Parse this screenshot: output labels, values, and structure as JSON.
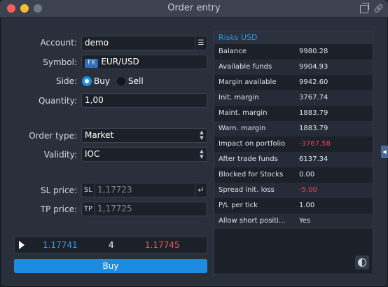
{
  "window": {
    "title": "Order entry"
  },
  "form": {
    "account": {
      "label": "Account:",
      "value": "demo"
    },
    "symbol": {
      "label": "Symbol:",
      "badge": "FX",
      "value": "EUR/USD"
    },
    "side": {
      "label": "Side:",
      "buy": "Buy",
      "sell": "Sell",
      "selected": "Buy"
    },
    "quantity": {
      "label": "Quantity:",
      "value": "1,00"
    },
    "order_type": {
      "label": "Order type:",
      "value": "Market"
    },
    "validity": {
      "label": "Validity:",
      "value": "IOC"
    },
    "sl_price": {
      "label": "SL price:",
      "prefix": "SL",
      "placeholder": "1,17723"
    },
    "tp_price": {
      "label": "TP price:",
      "prefix": "TP",
      "placeholder": "1,17725"
    }
  },
  "quote": {
    "bid": "1.17741",
    "quantity": "4",
    "ask": "1.17745"
  },
  "buy_button": {
    "label": "Buy"
  },
  "risks": {
    "title": "Risks USD",
    "rows": [
      {
        "name": "Balance",
        "value": "9980.28"
      },
      {
        "name": "Available funds",
        "value": "9904.93"
      },
      {
        "name": "Margin available",
        "value": "9942.60"
      },
      {
        "name": "Init. margin",
        "value": "3767.74"
      },
      {
        "name": "Maint. margin",
        "value": "1883.79"
      },
      {
        "name": "Warn. margin",
        "value": "1883.79"
      },
      {
        "name": "Impact on portfolio",
        "value": "-3767.58"
      },
      {
        "name": "After trade funds",
        "value": "6137.34"
      },
      {
        "name": "Blocked for Stocks",
        "value": "0.00"
      },
      {
        "name": "Spread init. loss",
        "value": "-5.00"
      },
      {
        "name": "P/L per tick",
        "value": "1.00"
      },
      {
        "name": "Allow short positi...",
        "value": "Yes"
      }
    ]
  },
  "colors": {
    "accent": "#1d8ce0",
    "negative": "#e2474f",
    "bid": "#3d9be9",
    "ask": "#f2545b"
  }
}
